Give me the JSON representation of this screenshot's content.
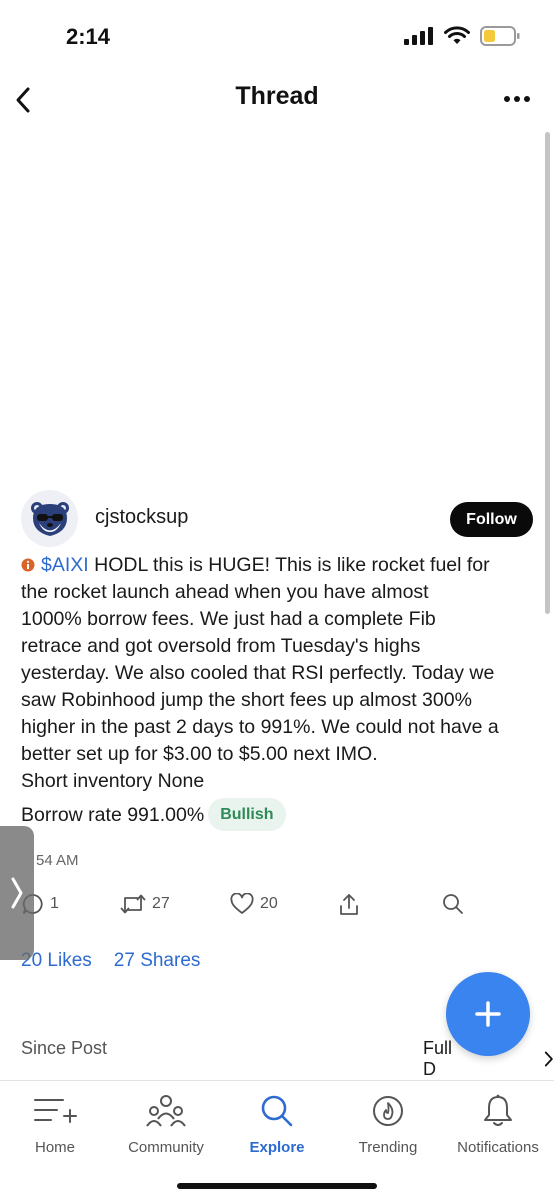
{
  "status": {
    "time": "2:14",
    "icons": [
      "signal-icon",
      "wifi-icon",
      "battery-icon"
    ],
    "battery_color": "#f4c93a"
  },
  "nav": {
    "title": "Thread",
    "back_icon": "chevron-left-icon",
    "more_icon": "more-horizontal-icon"
  },
  "post": {
    "username": "cjstocksup",
    "follow_label": "Follow",
    "avatar_icon": "bear-with-sunglasses-avatar",
    "cashtag": "$AIXI",
    "text_lines": [
      " HODL this is HUGE! This is like rocket fuel for",
      "the rocket launch ahead when you have almost",
      "1000% borrow fees. We just had a complete Fib",
      "retrace and got oversold from Tuesday's highs",
      "yesterday. We also cooled that RSI perfectly. Today we",
      "saw Robinhood jump the short fees up almost 300%",
      "higher in the past 2 days to 991%. We could not have a",
      "better set up for $3.00 to $5.00 next IMO."
    ],
    "short_inventory": "Short inventory None",
    "borrow_rate": "Borrow rate 991.00%",
    "sentiment": "Bullish",
    "time": "54 AM"
  },
  "actions": {
    "comments": "1",
    "reposts": "27",
    "likes": "20"
  },
  "stats": {
    "likes": "20 Likes",
    "shares": "27 Shares"
  },
  "section": {
    "since_post": "Since Post",
    "full_label": "Full D"
  },
  "tabs": [
    {
      "label": "Home",
      "icon": "home-list-icon"
    },
    {
      "label": "Community",
      "icon": "community-icon"
    },
    {
      "label": "Explore",
      "icon": "search-icon",
      "active": true
    },
    {
      "label": "Trending",
      "icon": "flame-icon"
    },
    {
      "label": "Notifications",
      "icon": "bell-icon"
    }
  ],
  "colors": {
    "accent": "#2d6bd1",
    "fab": "#3a84f0",
    "bullish": "#2e8b57",
    "follow_bg": "#0a0a0a"
  }
}
